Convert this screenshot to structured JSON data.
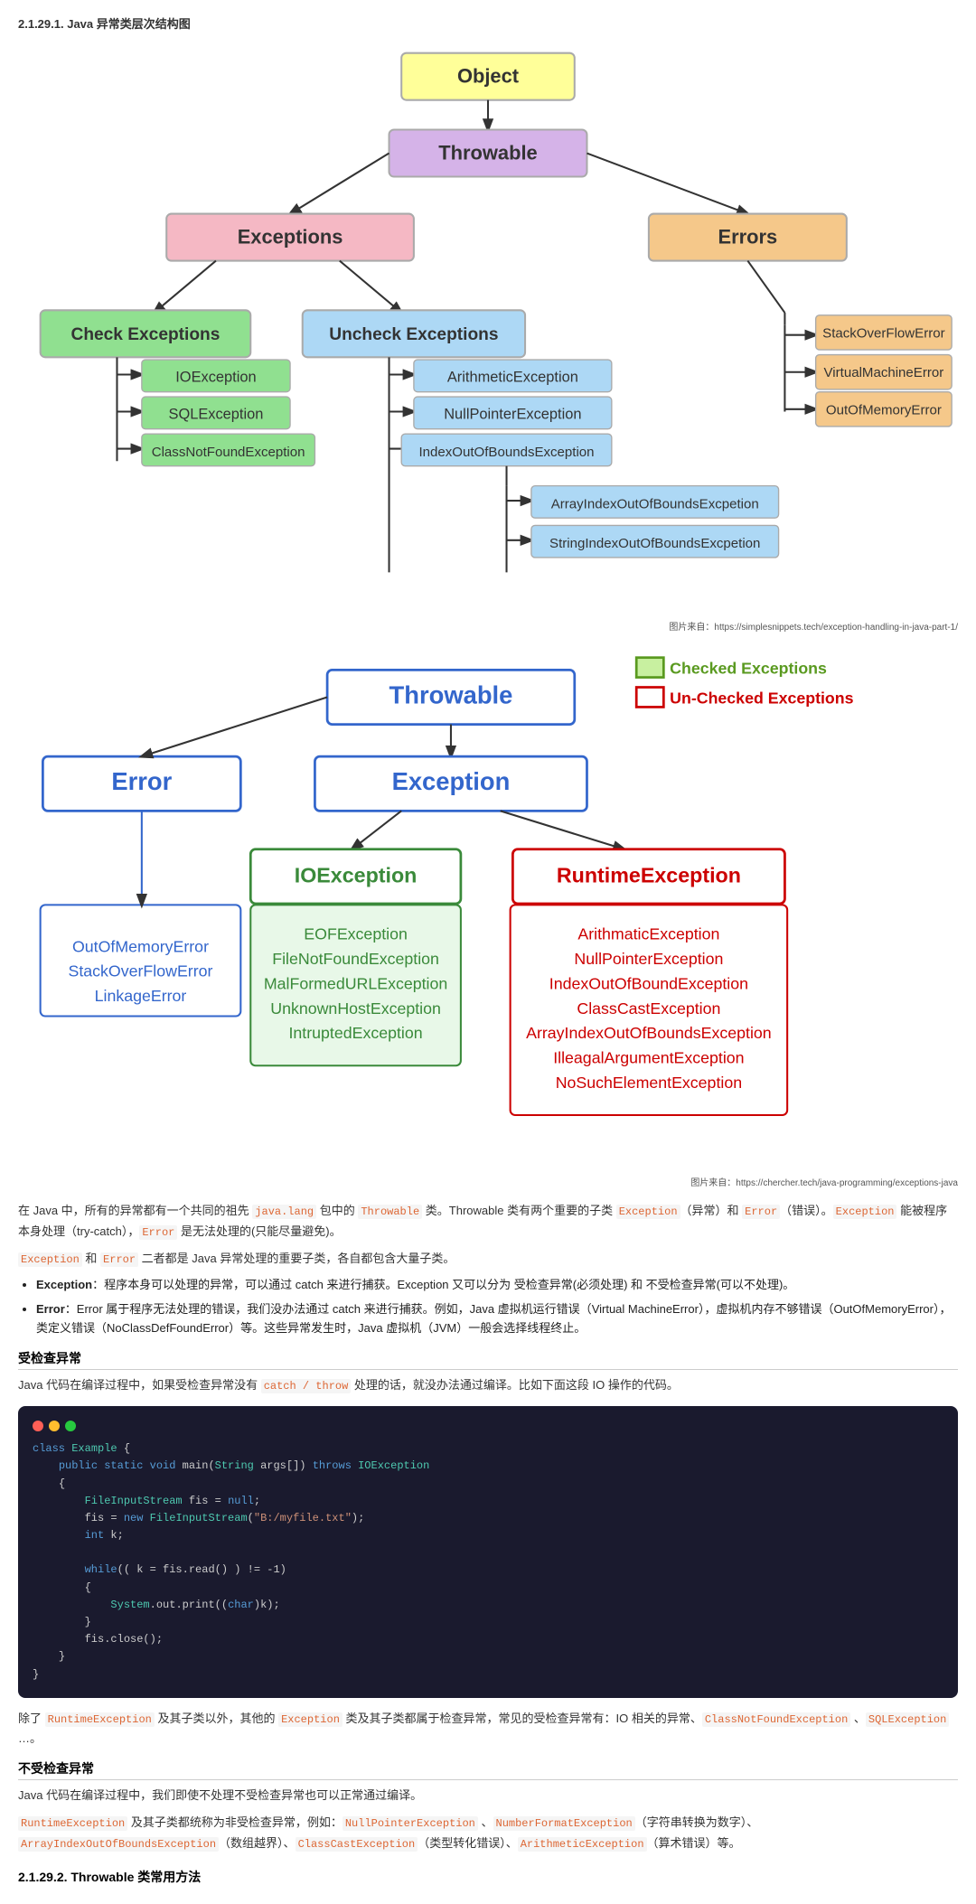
{
  "page": {
    "section1_title": "2.1.29.1. Java 异常类层次结构图",
    "source1": "图片来自：https://simplesnippets.tech/exception-handling-in-java-part-1/",
    "source2": "图片来自：https://chercher.tech/java-programming/exceptions-java",
    "legend": {
      "checked": "Checked Exceptions",
      "unchecked": "Un-Checked Exceptions"
    },
    "para1": "在 Java 中，所有的异常都有一个共同的祖先 java.lang 包中的 Throwable 类。Throwable 类有两个重要的子类 Exception（异常）和 Error（错误）。Exception 能被程序本身处理（try-catch），Error 是无法处理的(只能尽量避免)。",
    "para2": "Exception 和 Error 二者都是 Java 异常处理的重要子类，各自都包含大量子类。",
    "bullet1_title": "Exception",
    "bullet1_text": "：程序本身可以处理的异常，可以通过 catch 来进行捕获。Exception 又可以分为 受检查异常(必须处理) 和 不受检查异常(可以不处理)。",
    "bullet2_title": "Error",
    "bullet2_text": "：Error 属于程序无法处理的错误，我们没办法通过 catch 来进行捕获。例如，Java 虚拟机运行错误（Virtual MachineError），虚拟机内存不够错误（OutOfMemoryError），类定义错误（NoClassDefFoundError）等。这些异常发生时，Java 虚拟机（JVM）一般会选择线程终止。",
    "section2_heading": "受检查异常",
    "para3": "Java 代码在编译过程中，如果受检查异常没有 catch / throw 处理的话，就没办法通过编译。比如下面这段 IO 操作的代码。",
    "para4": "除了 RuntimeException 及其子类以外，其他的 Exception 类及其子类都属于检查异常，常见的受检查异常有：IO 相关的异常、ClassNotFoundException 、SQLException …。",
    "section3_heading": "不受检查异常",
    "para5": "Java 代码在编译过程中，我们即使不处理不受检查异常也可以正常通过编译。",
    "para6": "RuntimeException 及其子类都统称为非受检查异常，例如：NullPointerException 、NumberFormatException（字符串转换为数字）、ArrayIndexOutOfBoundsException（数组越界）、ClassCastException（类型转化错误）、ArithmeticException（算术错误）等。",
    "section4_heading": "2.1.29.2. Throwable 类常用方法"
  }
}
